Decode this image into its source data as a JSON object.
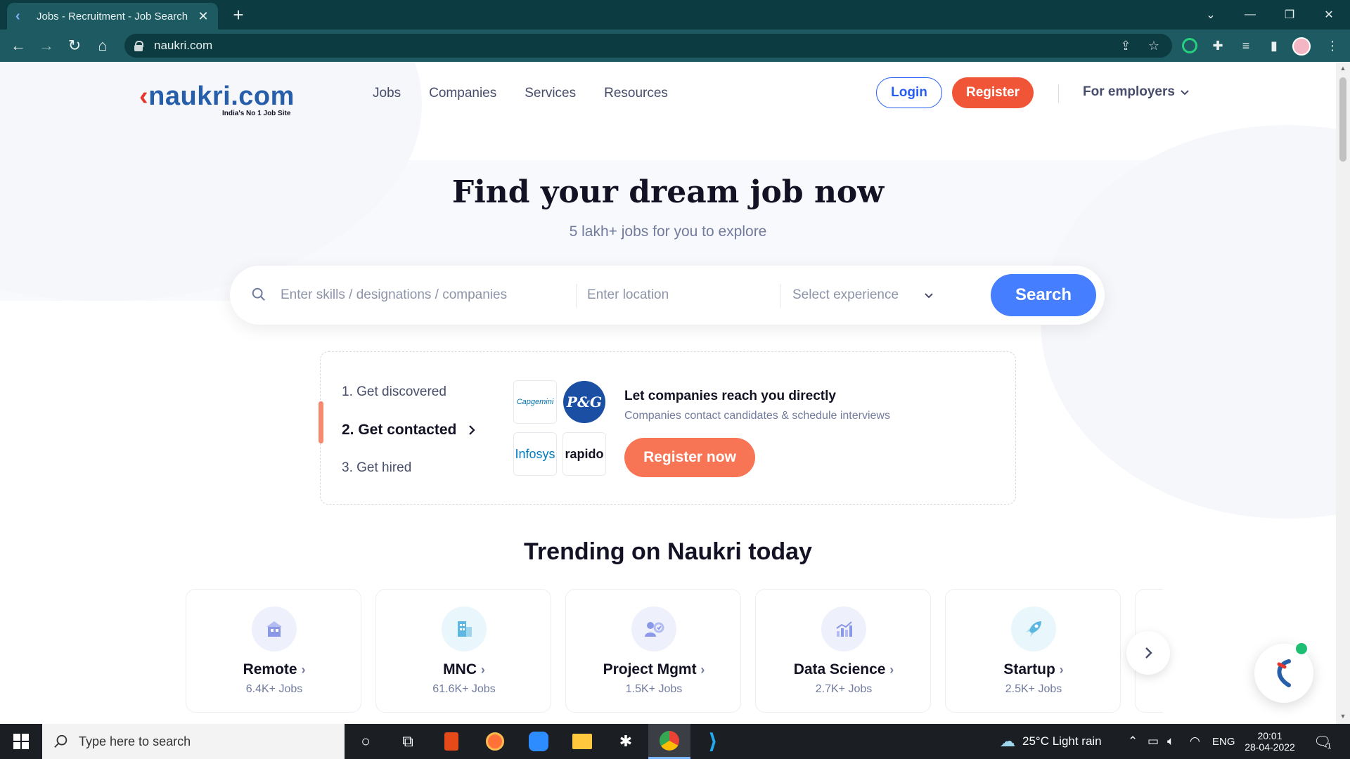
{
  "browser": {
    "tab_title": "Jobs - Recruitment - Job Search",
    "url": "naukri.com"
  },
  "header": {
    "logo_text": "naukri.com",
    "tagline": "India's No 1 Job Site",
    "nav": [
      "Jobs",
      "Companies",
      "Services",
      "Resources"
    ],
    "login": "Login",
    "register": "Register",
    "employers": "For employers"
  },
  "hero": {
    "title": "Find your dream job now",
    "subtitle": "5 lakh+ jobs for you to explore"
  },
  "search": {
    "skills_placeholder": "Enter skills / designations / companies",
    "location_placeholder": "Enter location",
    "experience_placeholder": "Select experience",
    "button": "Search"
  },
  "promo": {
    "steps": [
      "1. Get discovered",
      "2. Get contacted",
      "3. Get hired"
    ],
    "active_step": 1,
    "companies": [
      "Capgemini",
      "P&G",
      "Infosys",
      "rapido"
    ],
    "title": "Let companies reach you directly",
    "subtitle": "Companies contact candidates & schedule interviews",
    "button": "Register now"
  },
  "trending": {
    "title": "Trending on Naukri today",
    "cards": [
      {
        "name": "Remote",
        "count": "6.4K+ Jobs",
        "icon": "building-icon",
        "bg": "#eef0fb",
        "fg": "#8b98e8"
      },
      {
        "name": "MNC",
        "count": "61.6K+ Jobs",
        "icon": "skyscraper-icon",
        "bg": "#e9f6fb",
        "fg": "#5cb8e0"
      },
      {
        "name": "Project Mgmt",
        "count": "1.5K+ Jobs",
        "icon": "project-icon",
        "bg": "#eef0fb",
        "fg": "#8b98e8"
      },
      {
        "name": "Data Science",
        "count": "2.7K+ Jobs",
        "icon": "bar-chart-icon",
        "bg": "#eef0fb",
        "fg": "#8b98e8"
      },
      {
        "name": "Startup",
        "count": "2.5K+ Jobs",
        "icon": "rocket-icon",
        "bg": "#e9f6fb",
        "fg": "#5cb8e0"
      }
    ]
  },
  "taskbar": {
    "search_placeholder": "Type here to search",
    "weather": "25°C  Light rain",
    "lang": "ENG",
    "time": "20:01",
    "date": "28-04-2022",
    "notifications": "1"
  },
  "colors": {
    "brand_blue": "#275df5",
    "register_orange": "#f05537",
    "search_blue": "#457eff"
  }
}
